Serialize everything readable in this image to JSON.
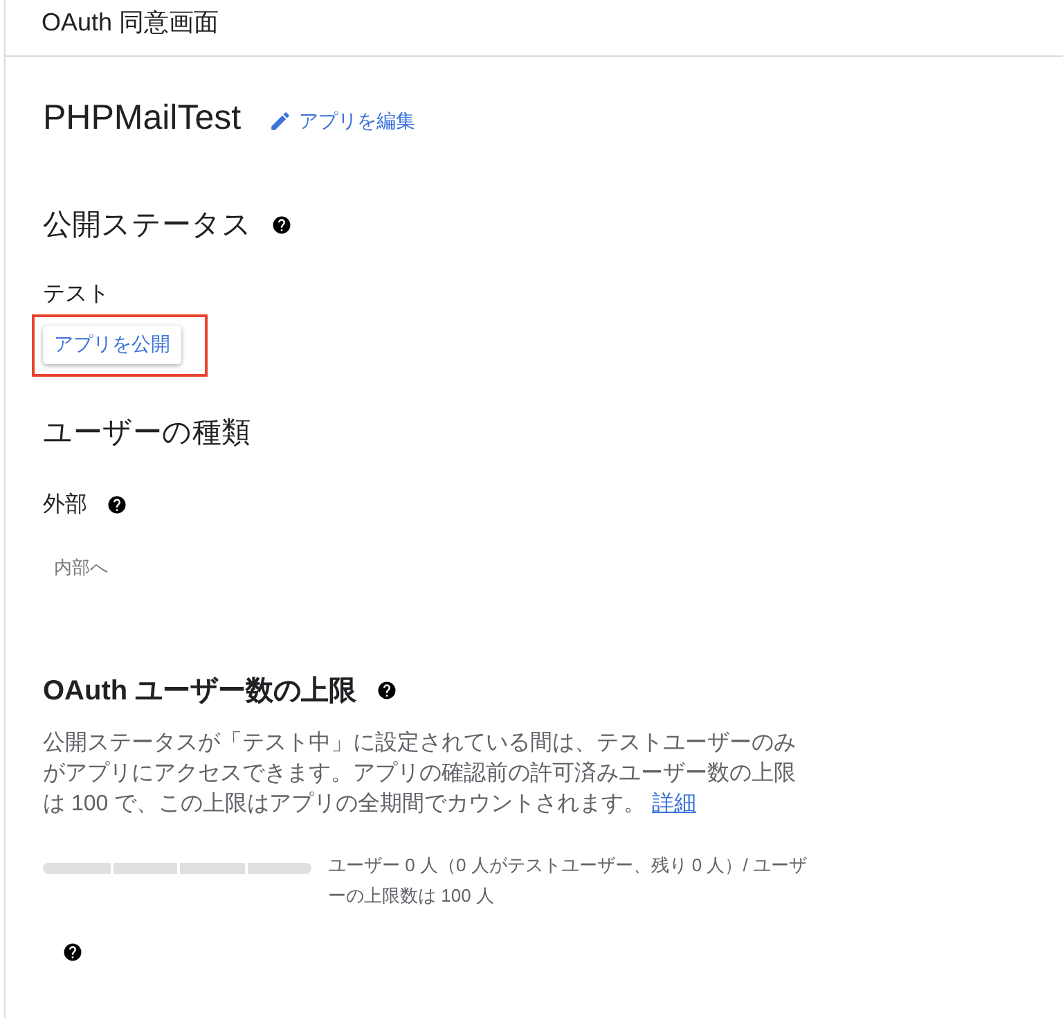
{
  "header": {
    "title": "OAuth 同意画面"
  },
  "app": {
    "name": "PHPMailTest",
    "edit_link": "アプリを編集"
  },
  "publishing": {
    "heading": "公開ステータス",
    "status": "テスト",
    "button": {
      "label": "アプリを公開",
      "highlighted": true
    }
  },
  "user_type": {
    "heading": "ユーザーの種類",
    "value": "外部",
    "switch_button": "内部へ"
  },
  "user_cap": {
    "heading": "OAuth ユーザー数の上限",
    "description": "公開ステータスが「テスト中」に設定されている間は、テストユーザーのみがアプリにアクセスできます。アプリの確認前の許可済みユーザー数の上限は 100 で、この上限はアプリの全期間でカウントされます。",
    "link": "詳細",
    "count_text": "ユーザー 0 人（0 人がテストユーザー、残り 0 人）/ ユーザーの上限数は 100 人"
  }
}
